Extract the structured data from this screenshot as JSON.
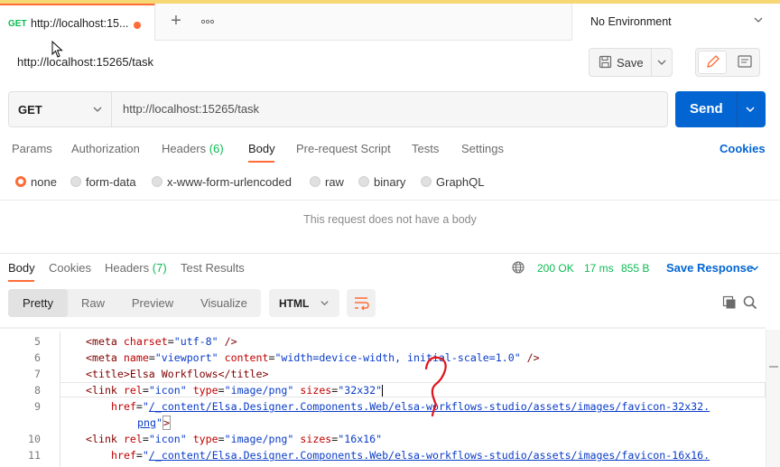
{
  "tab": {
    "method": "GET",
    "title": "http://localhost:15...",
    "unsaved": true
  },
  "environment": {
    "label": "No Environment"
  },
  "request": {
    "title": "http://localhost:15265/task",
    "save_label": "Save",
    "method": "GET",
    "url": "http://localhost:15265/task",
    "send_label": "Send"
  },
  "request_tabs": [
    {
      "label": "Params"
    },
    {
      "label": "Authorization"
    },
    {
      "label": "Headers",
      "count": "(6)"
    },
    {
      "label": "Body",
      "active": true
    },
    {
      "label": "Pre-request Script"
    },
    {
      "label": "Tests"
    },
    {
      "label": "Settings"
    }
  ],
  "cookies_label": "Cookies",
  "body_types": [
    {
      "label": "none",
      "checked": true
    },
    {
      "label": "form-data"
    },
    {
      "label": "x-www-form-urlencoded"
    },
    {
      "label": "raw"
    },
    {
      "label": "binary"
    },
    {
      "label": "GraphQL"
    }
  ],
  "no_body_message": "This request does not have a body",
  "response": {
    "tabs": [
      {
        "label": "Body",
        "active": true
      },
      {
        "label": "Cookies"
      },
      {
        "label": "Headers",
        "count": "(7)"
      },
      {
        "label": "Test Results"
      }
    ],
    "status": "200 OK",
    "time": "17 ms",
    "size": "855 B",
    "save_response_label": "Save Response",
    "views": [
      "Pretty",
      "Raw",
      "Preview",
      "Visualize"
    ],
    "active_view": "Pretty",
    "language": "HTML"
  },
  "code": {
    "line_numbers": [
      "5",
      "6",
      "7",
      "8",
      "9",
      "10",
      "11"
    ],
    "lines": {
      "l5": {
        "open": "<meta ",
        "attr1": "charset",
        "eq1": "=",
        "val1": "\"utf-8\"",
        "close": " />"
      },
      "l6": {
        "open": "<meta ",
        "attr1": "name",
        "eq1": "=",
        "val1": "\"viewport\"",
        "sp": " ",
        "attr2": "content",
        "eq2": "=",
        "val2": "\"width=device-width, initial-scale=1.0\"",
        "close": " />"
      },
      "l7": {
        "text": "<title>Elsa Workflows</title>"
      },
      "l8": {
        "open": "<link ",
        "attr1": "rel",
        "eq1": "=",
        "val1": "\"icon\"",
        "sp1": " ",
        "attr2": "type",
        "eq2": "=",
        "val2": "\"image/png\"",
        "sp2": " ",
        "attr3": "sizes",
        "eq3": "=",
        "val3": "\"32x32\""
      },
      "l9": {
        "attr": "href",
        "eq": "=",
        "q": "\"",
        "link": "/_content/Elsa.Designer.Components.Web/elsa-workflows-studio/assets/images/favicon-32x32.",
        "link2": "png",
        "q2": "\"",
        "close": ">"
      },
      "l10": {
        "open": "<link ",
        "attr1": "rel",
        "eq1": "=",
        "val1": "\"icon\"",
        "sp1": " ",
        "attr2": "type",
        "eq2": "=",
        "val2": "\"image/png\"",
        "sp2": " ",
        "attr3": "sizes",
        "eq3": "=",
        "val3": "\"16x16\""
      },
      "l11": {
        "attr": "href",
        "eq": "=",
        "q": "\"",
        "link": "/_content/Elsa.Designer.Components.Web/elsa-workflows-studio/assets/images/favicon-16x16."
      }
    }
  },
  "colors": {
    "accent": "#ff6c37",
    "primary": "#0265d2",
    "success": "#0cbb52"
  },
  "icons": [
    "plus-icon",
    "more-icon",
    "chevron-down-icon",
    "save-icon",
    "edit-icon",
    "document-icon",
    "globe-icon",
    "wrap-icon",
    "copy-icon",
    "search-icon",
    "mouse-cursor-icon",
    "annotation-question-mark"
  ]
}
